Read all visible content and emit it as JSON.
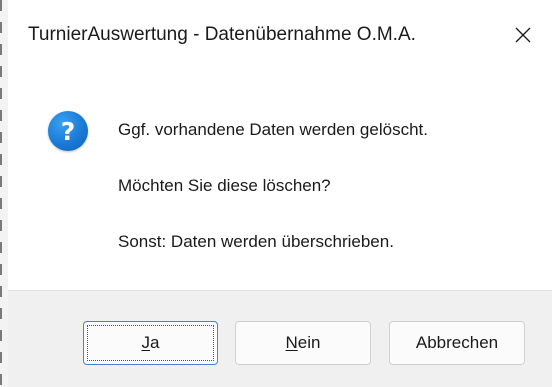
{
  "window": {
    "title": "TurnierAuswertung - Datenübernahme O.M.A."
  },
  "icons": {
    "question": "question-icon",
    "close": "close-icon"
  },
  "message": {
    "line1": "Ggf. vorhandene Daten werden gelöscht.",
    "line2": "Möchten Sie diese löschen?",
    "line3": "Sonst: Daten werden überschrieben."
  },
  "buttons": {
    "yes": {
      "mnemonic": "J",
      "rest": "a"
    },
    "no": {
      "mnemonic": "N",
      "rest": "ein"
    },
    "cancel": "Abbrechen"
  },
  "colors": {
    "accent": "#1a7ad6",
    "default_button_border": "#4a7fd0",
    "footer_background": "#f0f0f0"
  }
}
